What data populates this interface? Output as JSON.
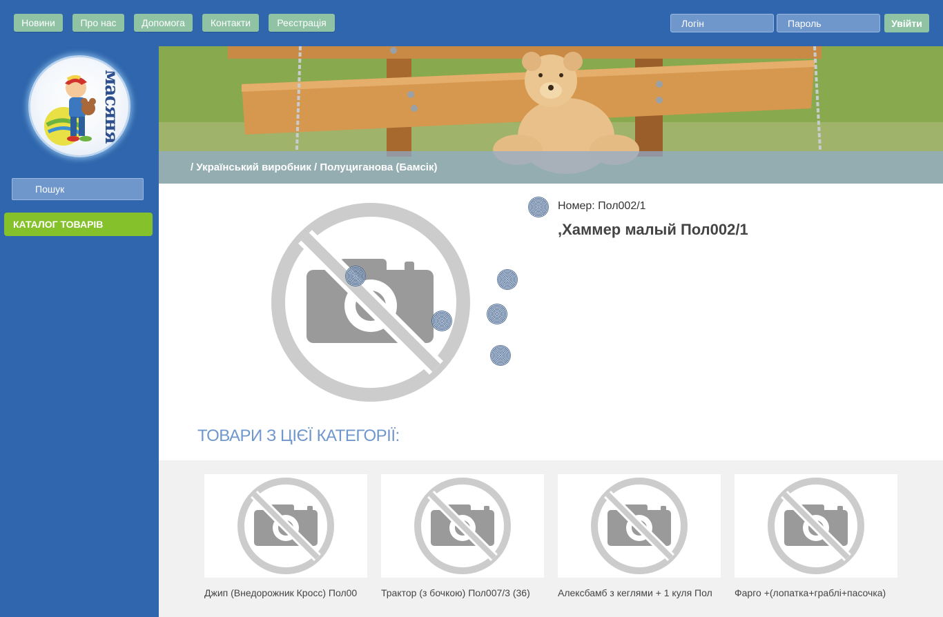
{
  "nav": {
    "items": [
      "Новини",
      "Про нас",
      "Допомога",
      "Контакти",
      "Реєстрація"
    ]
  },
  "auth": {
    "login_placeholder": "Логін",
    "password_placeholder": "Пароль",
    "submit_label": "Увійти"
  },
  "sidebar": {
    "logo_text": "масяня",
    "search_placeholder": "Пошук",
    "catalog_label": "КАТАЛОГ ТОВАРІВ"
  },
  "breadcrumb": "/ Український виробник / Полуциганова (Бамсік)",
  "product": {
    "number_text": "Номер: Пол002/1",
    "name": ",Хаммер малый Пол002/1"
  },
  "related": {
    "title": "ТОВАРИ З ЦІЄЇ КАТЕГОРІЇ:",
    "items": [
      {
        "name": "Джип (Внедорожник Кросс) Пол00"
      },
      {
        "name": "Трактор (з бочкою) Пол007/3 (36)"
      },
      {
        "name": "Алексбамб з кеглями + 1 куля Пол"
      },
      {
        "name": "Фарго +(лопатка+граблі+пасочка)"
      }
    ]
  },
  "colors": {
    "background": "#2f66ad",
    "nav_button": "#8fc3a4",
    "catalog_button": "#84c12a",
    "section_title": "#6f97cc"
  }
}
